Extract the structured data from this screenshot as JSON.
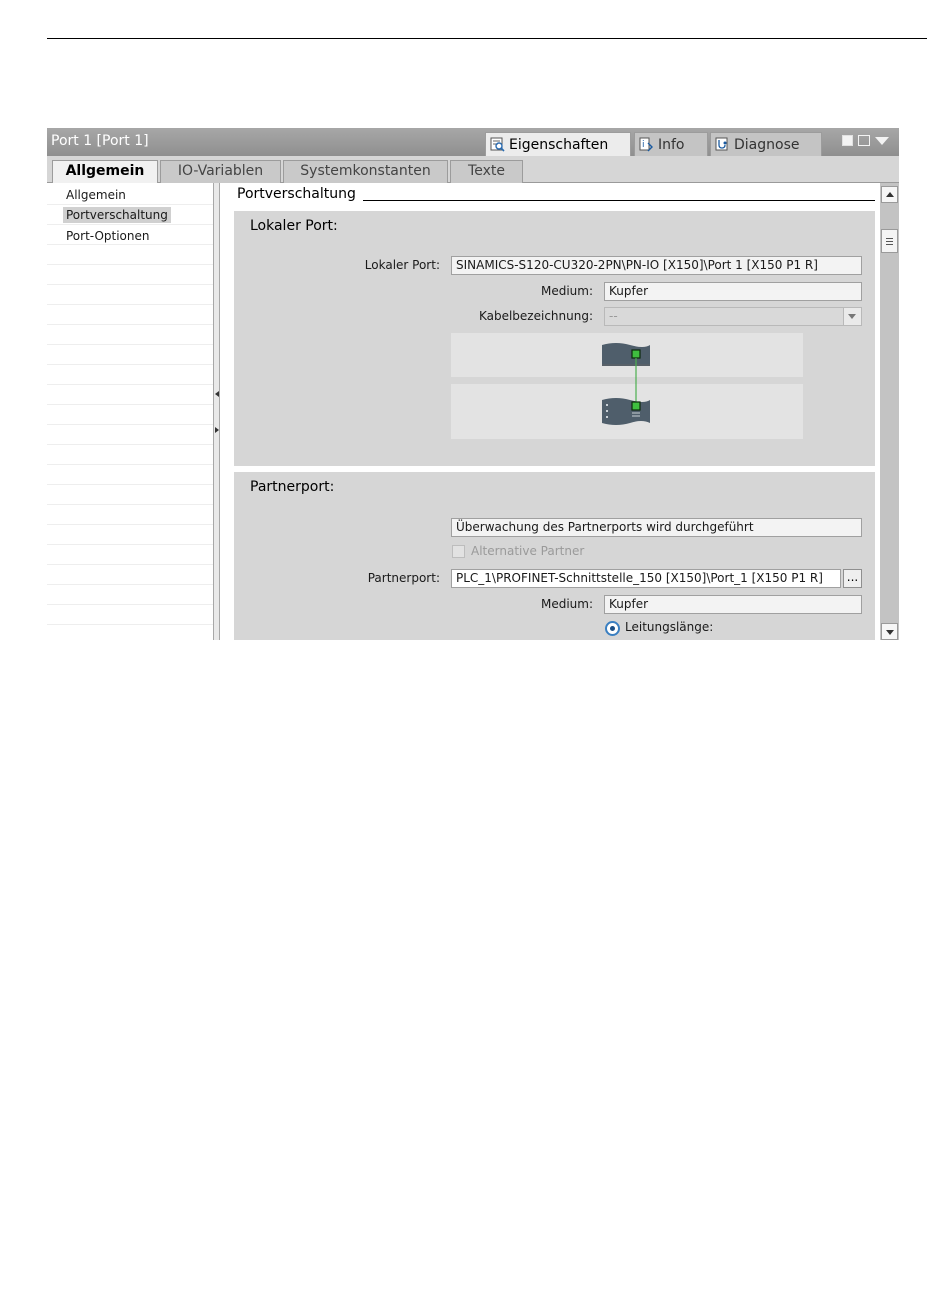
{
  "window": {
    "title": "Port 1 [Port 1]",
    "inspector_tabs": [
      {
        "label": "Eigenschaften",
        "icon": "properties-icon"
      },
      {
        "label": "Info",
        "icon": "info-icon"
      },
      {
        "label": "Diagnose",
        "icon": "diagnostics-icon"
      }
    ]
  },
  "tabs": [
    "Allgemein",
    "IO-Variablen",
    "Systemkonstanten",
    "Texte"
  ],
  "nav": {
    "items": [
      "Allgemein",
      "Portverschaltung",
      "Port-Optionen"
    ],
    "selected": "Portverschaltung"
  },
  "content": {
    "section_title": "Portverschaltung",
    "local": {
      "title": "Lokaler Port:",
      "port_label": "Lokaler Port:",
      "port_value": "SINAMICS-S120-CU320-2PN\\PN-IO [X150]\\Port 1 [X150 P1 R]",
      "medium_label": "Medium:",
      "medium_value": "Kupfer",
      "cable_label": "Kabelbezeichnung:",
      "cable_value": "--"
    },
    "partner": {
      "title": "Partnerport:",
      "monitoring_text": "Überwachung des Partnerports wird durchgeführt",
      "alt_partner_label": "Alternative Partner",
      "port_label": "Partnerport:",
      "port_value": "PLC_1\\PROFINET-Schnittstelle_150 [X150]\\Port_1 [X150 P1 R]",
      "browse_label": "...",
      "medium_label": "Medium:",
      "medium_value": "Kupfer",
      "cable_length_label": "Leitungslänge:"
    }
  },
  "colors": {
    "titlebar": "#9a9a9a",
    "group_bg": "#d6d6d6",
    "connection_line": "#4caf50",
    "port_green": "#3fbf3f",
    "device_dark": "#4f5e6b",
    "radio_accent": "#3a7fc1"
  }
}
